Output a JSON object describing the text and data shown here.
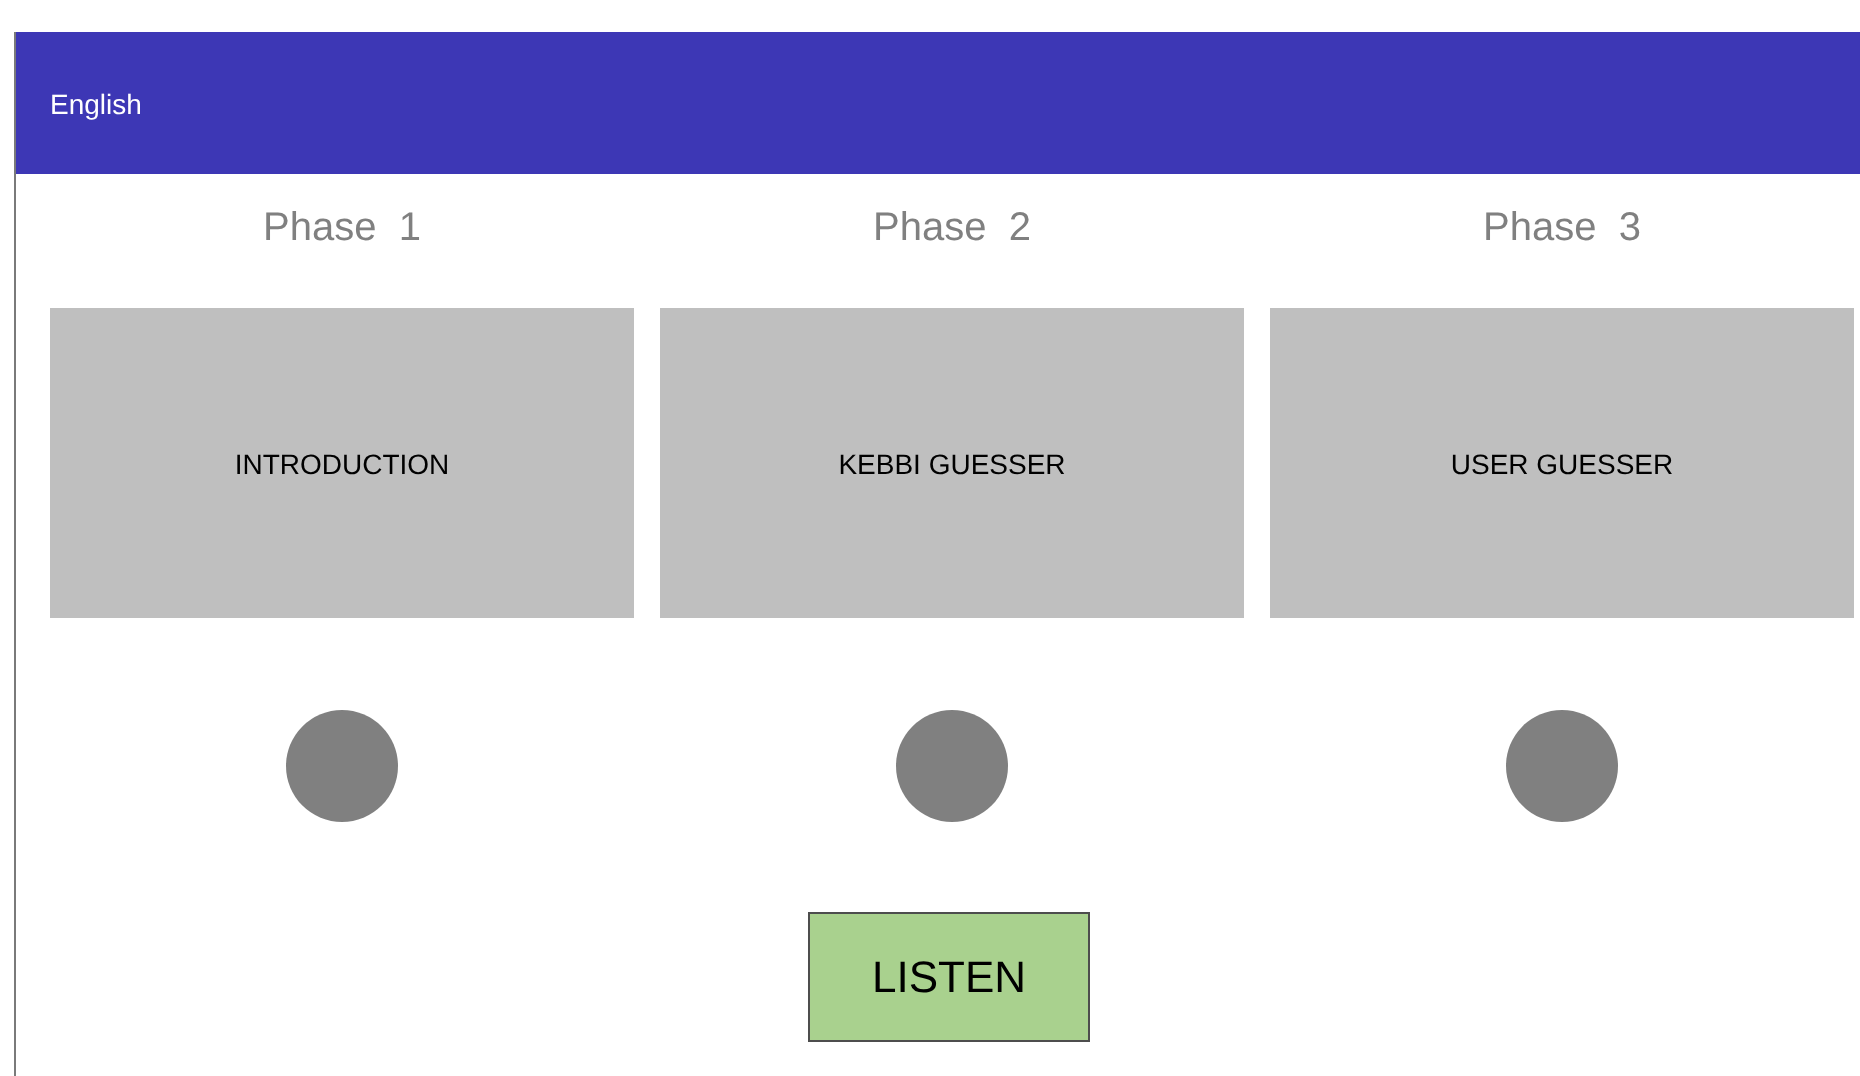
{
  "header": {
    "title": "English"
  },
  "phases": [
    {
      "label": "Phase  1",
      "card": "INTRODUCTION"
    },
    {
      "label": "Phase  2",
      "card": "KEBBI GUESSER"
    },
    {
      "label": "Phase  3",
      "card": "USER GUESSER"
    }
  ],
  "button": "LISTEN"
}
